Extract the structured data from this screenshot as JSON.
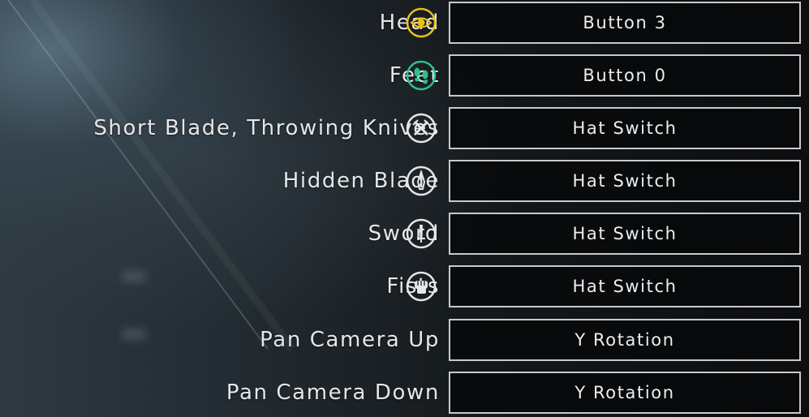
{
  "bindings": [
    {
      "label": "Head",
      "value": "Button 3",
      "icon": "eye-icon",
      "icon_color": "#e8c21c"
    },
    {
      "label": "Feet",
      "value": "Button 0",
      "icon": "footprints-icon",
      "icon_color": "#2ec08a"
    },
    {
      "label": "Short Blade, Throwing Knives",
      "value": "Hat Switch",
      "icon": "crossed-blades-icon",
      "icon_color": "#e6e6e6"
    },
    {
      "label": "Hidden Blade",
      "value": "Hat Switch",
      "icon": "hidden-blade-icon",
      "icon_color": "#e6e6e6"
    },
    {
      "label": "Sword",
      "value": "Hat Switch",
      "icon": "sword-icon",
      "icon_color": "#e6e6e6"
    },
    {
      "label": "Fists",
      "value": "Hat Switch",
      "icon": "fist-icon",
      "icon_color": "#e6e6e6"
    },
    {
      "label": "Pan Camera Up",
      "value": "Y Rotation",
      "icon": null,
      "icon_color": null
    },
    {
      "label": "Pan Camera Down",
      "value": "Y Rotation",
      "icon": null,
      "icon_color": null
    }
  ]
}
